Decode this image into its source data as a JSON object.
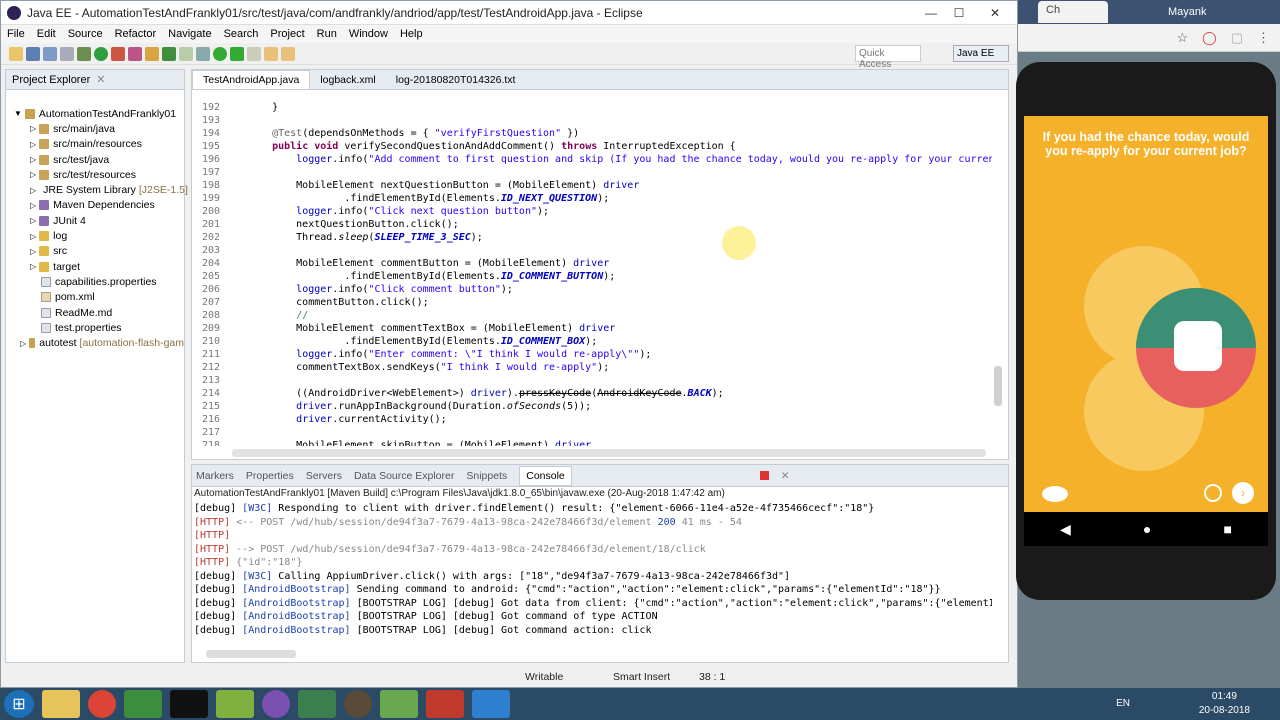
{
  "window": {
    "title": "Java EE - AutomationTestAndFrankly01/src/test/java/com/andfrankly/andriod/app/test/TestAndroidApp.java - Eclipse",
    "minimize": "—",
    "maximize": "☐",
    "close": "✕"
  },
  "menu": [
    "File",
    "Edit",
    "Source",
    "Refactor",
    "Navigate",
    "Search",
    "Project",
    "Run",
    "Window",
    "Help"
  ],
  "toolbar": {
    "quick_access": "Quick Access",
    "perspective": "Java EE"
  },
  "project_explorer": {
    "title": "Project Explorer",
    "root": "AutomationTestAndFrankly01",
    "items": [
      {
        "label": "src/main/java",
        "type": "pkg"
      },
      {
        "label": "src/main/resources",
        "type": "pkg"
      },
      {
        "label": "src/test/java",
        "type": "pkg"
      },
      {
        "label": "src/test/resources",
        "type": "pkg"
      },
      {
        "label": "JRE System Library",
        "extra": "[J2SE-1.5]",
        "type": "lib"
      },
      {
        "label": "Maven Dependencies",
        "type": "lib"
      },
      {
        "label": "JUnit 4",
        "type": "lib"
      },
      {
        "label": "log",
        "type": "folder"
      },
      {
        "label": "src",
        "type": "folder"
      },
      {
        "label": "target",
        "type": "folder"
      },
      {
        "label": "capabilities.properties",
        "type": "file"
      },
      {
        "label": "pom.xml",
        "type": "file"
      },
      {
        "label": "ReadMe.md",
        "type": "file"
      },
      {
        "label": "test.properties",
        "type": "file"
      }
    ],
    "second_root": "autotest",
    "second_root_extra": "[automation-flash-gam"
  },
  "editor": {
    "tabs": [
      "TestAndroidApp.java",
      "logback.xml",
      "log-20180820T014326.txt"
    ],
    "line_numbers": [
      "192",
      "193",
      "194",
      "195",
      "196",
      "197",
      "198",
      "199",
      "200",
      "201",
      "202",
      "203",
      "204",
      "205",
      "206",
      "207",
      "208",
      "209",
      "210",
      "211",
      "212",
      "213",
      "214",
      "215",
      "216",
      "217",
      "218"
    ]
  },
  "console": {
    "tabs": [
      "Markers",
      "Properties",
      "Servers",
      "Data Source Explorer",
      "Snippets",
      "Console"
    ],
    "path": "AutomationTestAndFrankly01 [Maven Build] c:\\Program Files\\Java\\jdk1.8.0_65\\bin\\javaw.exe (20-Aug-2018 1:47:42 am)"
  },
  "status": {
    "mode": "Writable",
    "insert": "Smart Insert",
    "position": "38 : 1"
  },
  "chrome": {
    "tab_title": "Ch",
    "user": "Mayank"
  },
  "phone": {
    "question": "If you had the chance today, would you re-apply for your current job?"
  },
  "taskbar": {
    "lang": "EN",
    "time": "01:49",
    "date": "20-08-2018"
  }
}
